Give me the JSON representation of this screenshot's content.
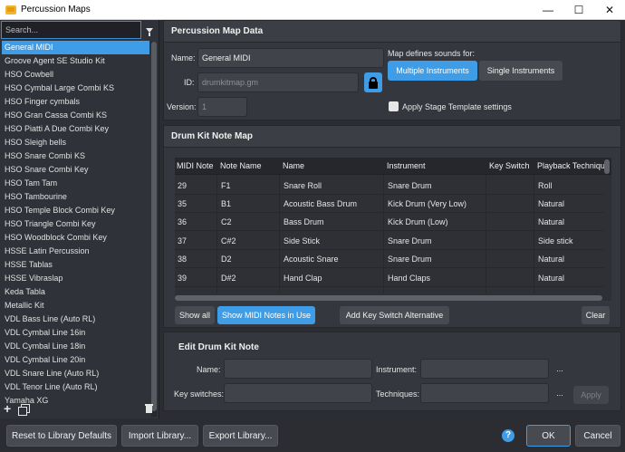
{
  "window": {
    "title": "Percussion Maps",
    "controls": [
      "—",
      "☐",
      "✕"
    ]
  },
  "search": {
    "placeholder": "Search..."
  },
  "maps": [
    "General MIDI",
    "Groove Agent SE Studio Kit",
    "HSO Cowbell",
    "HSO Cymbal Large Combi KS",
    "HSO Finger cymbals",
    "HSO Gran Cassa Combi KS",
    "HSO Piatti A Due Combi Key",
    "HSO Sleigh bells",
    "HSO Snare Combi KS",
    "HSO Snare Combi Key",
    "HSO Tam Tam",
    "HSO Tambourine",
    "HSO Temple Block Combi Key",
    "HSO Triangle Combi Key",
    "HSO Woodblock Combi Key",
    "HSSE Latin Percussion",
    "HSSE Tablas",
    "HSSE Vibraslap",
    "Keda Tabla",
    "Metallic Kit",
    "VDL Bass Line (Auto RL)",
    "VDL Cymbal Line 16in",
    "VDL Cymbal Line 18in",
    "VDL Cymbal Line 20in",
    "VDL Snare Line (Auto RL)",
    "VDL Tenor Line (Auto RL)",
    "Yamaha XG"
  ],
  "map_data": {
    "header": "Percussion Map Data",
    "name_label": "Name:",
    "name_value": "General MIDI",
    "id_label": "ID:",
    "id_value": "drumkitmap.gm",
    "version_label": "Version:",
    "version_value": "1",
    "defines_label": "Map defines sounds for:",
    "multiple_label": "Multiple Instruments",
    "single_label": "Single Instruments",
    "stage_label": "Apply Stage Template settings"
  },
  "note_map": {
    "header": "Drum Kit Note Map",
    "columns": [
      "MIDI Note",
      "Note Name",
      "Name",
      "Instrument",
      "Key Switch",
      "Playback Technique"
    ],
    "rows": [
      [
        "29",
        "F1",
        "Snare Roll",
        "Snare Drum",
        "",
        "Roll"
      ],
      [
        "35",
        "B1",
        "Acoustic Bass Drum",
        "Kick Drum (Very Low)",
        "",
        "Natural"
      ],
      [
        "36",
        "C2",
        "Bass Drum",
        "Kick Drum (Low)",
        "",
        "Natural"
      ],
      [
        "37",
        "C#2",
        "Side Stick",
        "Snare Drum",
        "",
        "Side stick"
      ],
      [
        "38",
        "D2",
        "Acoustic Snare",
        "Snare Drum",
        "",
        "Natural"
      ],
      [
        "39",
        "D#2",
        "Hand Clap",
        "Hand Claps",
        "",
        "Natural"
      ]
    ],
    "show_all": "Show all",
    "show_midi": "Show MIDI Notes in Use",
    "add_ks": "Add Key Switch Alternative",
    "clear": "Clear"
  },
  "edit": {
    "header": "Edit Drum Kit Note",
    "name_label": "Name:",
    "instrument_label": "Instrument:",
    "keyswitch_label": "Key switches:",
    "techniques_label": "Techniques:",
    "ellipsis": "...",
    "apply": "Apply"
  },
  "footer": {
    "reset": "Reset to Library Defaults",
    "import": "Import Library...",
    "export": "Export Library...",
    "help": "?",
    "ok": "OK",
    "cancel": "Cancel"
  },
  "colors": {
    "accent": "#3e9de6",
    "background": "#2b2d33",
    "panel": "#34373d"
  }
}
